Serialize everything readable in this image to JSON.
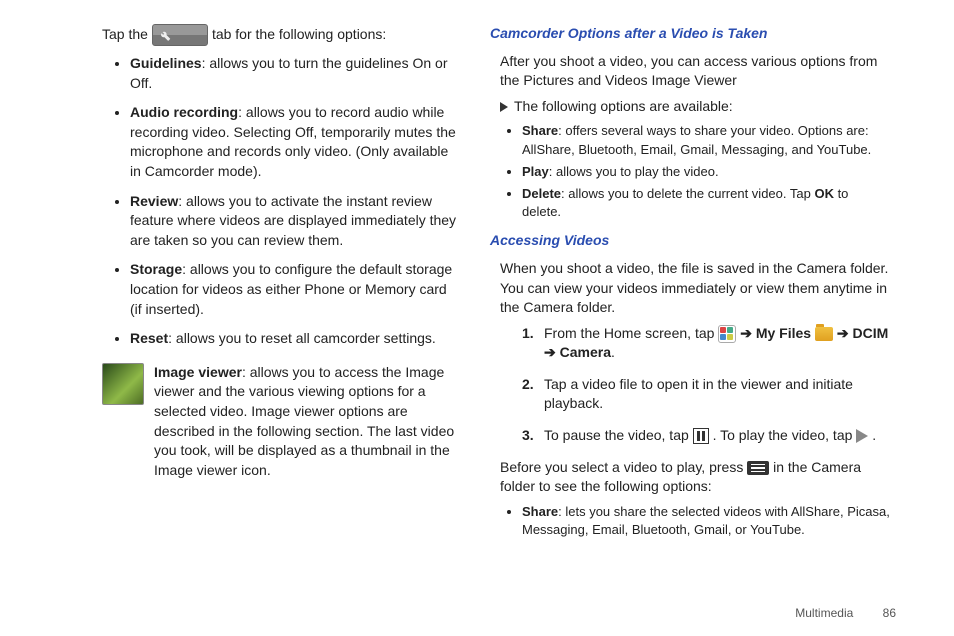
{
  "left": {
    "intro_pre": "Tap the ",
    "intro_post": " tab for the following options:",
    "bullets": [
      {
        "title": "Guidelines",
        "text": ": allows you to turn the guidelines On or Off."
      },
      {
        "title": "Audio recording",
        "text": ": allows you to record audio while recording video. Selecting Off, temporarily mutes the microphone and records only video. (Only available in Camcorder mode)."
      },
      {
        "title": "Review",
        "text": ": allows you to activate the instant review feature where videos are displayed immediately they are taken so you can review them."
      },
      {
        "title": "Storage",
        "text": ": allows you to configure the default storage location for videos as either Phone or Memory card (if inserted)."
      },
      {
        "title": "Reset",
        "text": ": allows you to reset all camcorder settings."
      }
    ],
    "image_viewer_title": "Image viewer",
    "image_viewer_text": ": allows you to access the Image viewer and the various viewing options for a selected video. Image viewer options are described in the following section. The last video you took, will be displayed as a thumbnail in the Image viewer icon."
  },
  "right": {
    "section1_title": "Camcorder Options after a Video is Taken",
    "section1_intro": "After you shoot a video, you can access various options from the Pictures and Videos Image Viewer",
    "section1_arrow": "The following options are available:",
    "section1_bullets": [
      {
        "title": "Share",
        "text": ": offers several ways to share your video. Options are: AllShare, Bluetooth, Email, Gmail, Messaging, and YouTube."
      },
      {
        "title": "Play",
        "text": ": allows you to play the video."
      },
      {
        "title": "Delete",
        "text_pre": ": allows you to delete the current video. Tap ",
        "bold_mid": "OK",
        "text_post": " to delete."
      }
    ],
    "section2_title": "Accessing Videos",
    "section2_intro": "When you shoot a video, the file is saved in the Camera folder. You can view your videos immediately or view them anytime in the Camera folder.",
    "steps": {
      "s1_pre": "From the Home screen, tap ",
      "arrow": "➔",
      "my_files": " My Files ",
      "dcim": " DCIM ",
      "camera": " Camera",
      "s2": "Tap a video file to open it in the viewer and initiate playback.",
      "s3_pre": "To pause the video, tap ",
      "s3_mid": ". To play the video, tap ",
      "s3_post": "."
    },
    "before_pre": "Before you select a video to play, press ",
    "before_post": " in the Camera folder to see the following options:",
    "share_bullet_title": "Share",
    "share_bullet_text": ": lets you share the selected videos with AllShare, Picasa, Messaging,  Email, Bluetooth, Gmail, or YouTube."
  },
  "footer": {
    "section": "Multimedia",
    "page": "86"
  }
}
